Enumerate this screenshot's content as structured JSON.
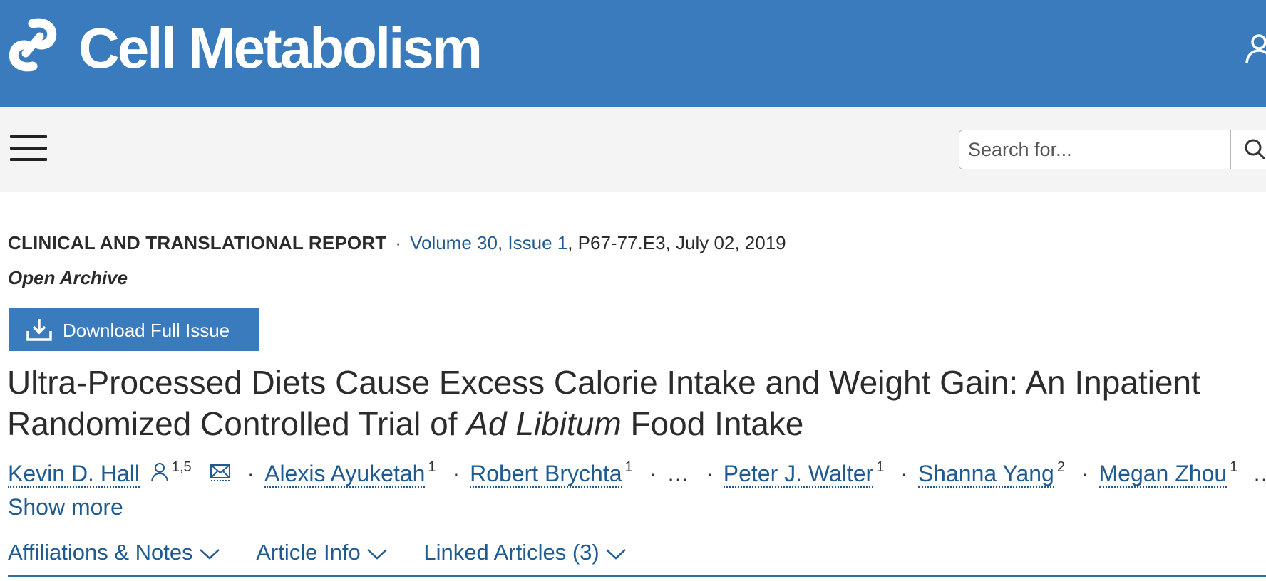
{
  "header": {
    "brand": "Cell Metabolism",
    "logo_icon": "cell-press-logo-icon",
    "user_icon": "user-icon",
    "colors": {
      "header_bg": "#3a7bbd",
      "link": "#1f5b91",
      "nav_bg": "#f4f4f4"
    }
  },
  "nav": {
    "menu_icon": "hamburger-menu-icon",
    "search_placeholder": "Search for...",
    "search_icon": "search-icon"
  },
  "article": {
    "type": "CLINICAL AND TRANSLATIONAL REPORT",
    "separator": "·",
    "volume_issue": "Volume 30, Issue 1",
    "pages_date": ", P67-77.E3, July 02, 2019",
    "access": "Open Archive",
    "download_label": "Download Full Issue",
    "title_part1": "Ultra-Processed Diets Cause Excess Calorie Intake and Weight Gain: An Inpatient Randomized Controlled Trial of ",
    "title_italic": "Ad Libitum",
    "title_part2": " Food Intake"
  },
  "authors": {
    "list": [
      {
        "name": "Kevin D. Hall",
        "sup": "1,5"
      },
      {
        "name": "Alexis Ayuketah",
        "sup": "1"
      },
      {
        "name": "Robert Brychta",
        "sup": "1"
      },
      {
        "name": "Peter J. Walter",
        "sup": "1"
      },
      {
        "name": "Shanna Yang",
        "sup": "2"
      },
      {
        "name": "Megan Zhou",
        "sup": "1"
      }
    ],
    "ellipsis": "…",
    "show_more": "Show more"
  },
  "tabs": [
    {
      "label": "Affiliations & Notes"
    },
    {
      "label": "Article Info"
    },
    {
      "label": "Linked Articles (3)"
    }
  ]
}
